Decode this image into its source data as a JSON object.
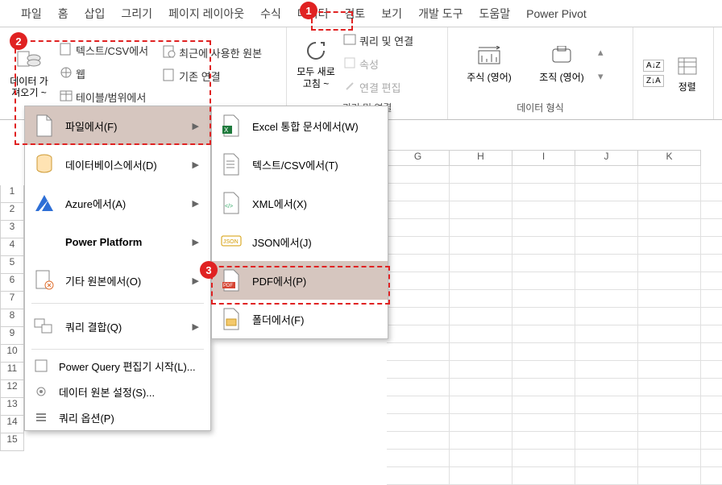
{
  "tabs": [
    "파일",
    "홈",
    "삽입",
    "그리기",
    "페이지 레이아웃",
    "수식",
    "데이터",
    "검토",
    "보기",
    "개발 도구",
    "도움말",
    "Power Pivot"
  ],
  "activeTabIndex": 6,
  "ribbon": {
    "getData": "데이터 가\n져오기 ~",
    "fromTextCsv": "텍스트/CSV에서",
    "fromWeb": "웹",
    "fromTableRange": "테이블/범위에서",
    "recentSources": "최근에 사용한 원본",
    "existingConn": "기존 연결",
    "refreshAll": "모두 새로\n고침 ~",
    "queriesConn": "쿼리 및 연결",
    "properties": "속성",
    "editLinks": "연결 편집",
    "queriesGroupLabel": "쿼리 및 연결",
    "stocks": "주식 (영어)",
    "org": "조직 (영어)",
    "dataTypesLabel": "데이터 형식",
    "sort": "정렬"
  },
  "menu1": {
    "fromFile": "파일에서(F)",
    "fromDatabase": "데이터베이스에서(D)",
    "fromAzure": "Azure에서(A)",
    "powerPlatform": "Power Platform",
    "fromOther": "기타 원본에서(O)",
    "combine": "쿼리 결합(Q)",
    "launchPQ": "Power Query 편집기 시작(L)...",
    "dataSourceSettings": "데이터 원본 설정(S)...",
    "queryOptions": "쿼리 옵션(P)"
  },
  "menu2": {
    "fromWorkbook": "Excel 통합 문서에서(W)",
    "fromTextCsv": "텍스트/CSV에서(T)",
    "fromXml": "XML에서(X)",
    "fromJson": "JSON에서(J)",
    "fromPdf": "PDF에서(P)",
    "fromFolder": "폴더에서(F)"
  },
  "cols": [
    "G",
    "H",
    "I",
    "J",
    "K"
  ],
  "rows": [
    "1",
    "2",
    "3",
    "4",
    "5",
    "6",
    "7",
    "8",
    "9",
    "10",
    "11",
    "12",
    "13",
    "14",
    "15"
  ],
  "badges": {
    "b1": "1",
    "b2": "2",
    "b3": "3"
  }
}
